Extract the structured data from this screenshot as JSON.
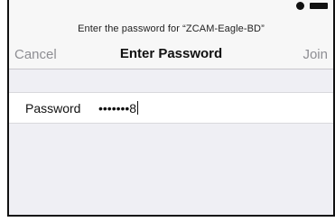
{
  "header": {
    "prompt": "Enter the password for “ZCAM-Eagle-BD”",
    "cancel_label": "Cancel",
    "title": "Enter Password",
    "join_label": "Join"
  },
  "form": {
    "password_label": "Password",
    "password_value": "•••••••8"
  },
  "icons": {
    "status_right": [
      "alarm-icon",
      "battery-icon"
    ]
  }
}
